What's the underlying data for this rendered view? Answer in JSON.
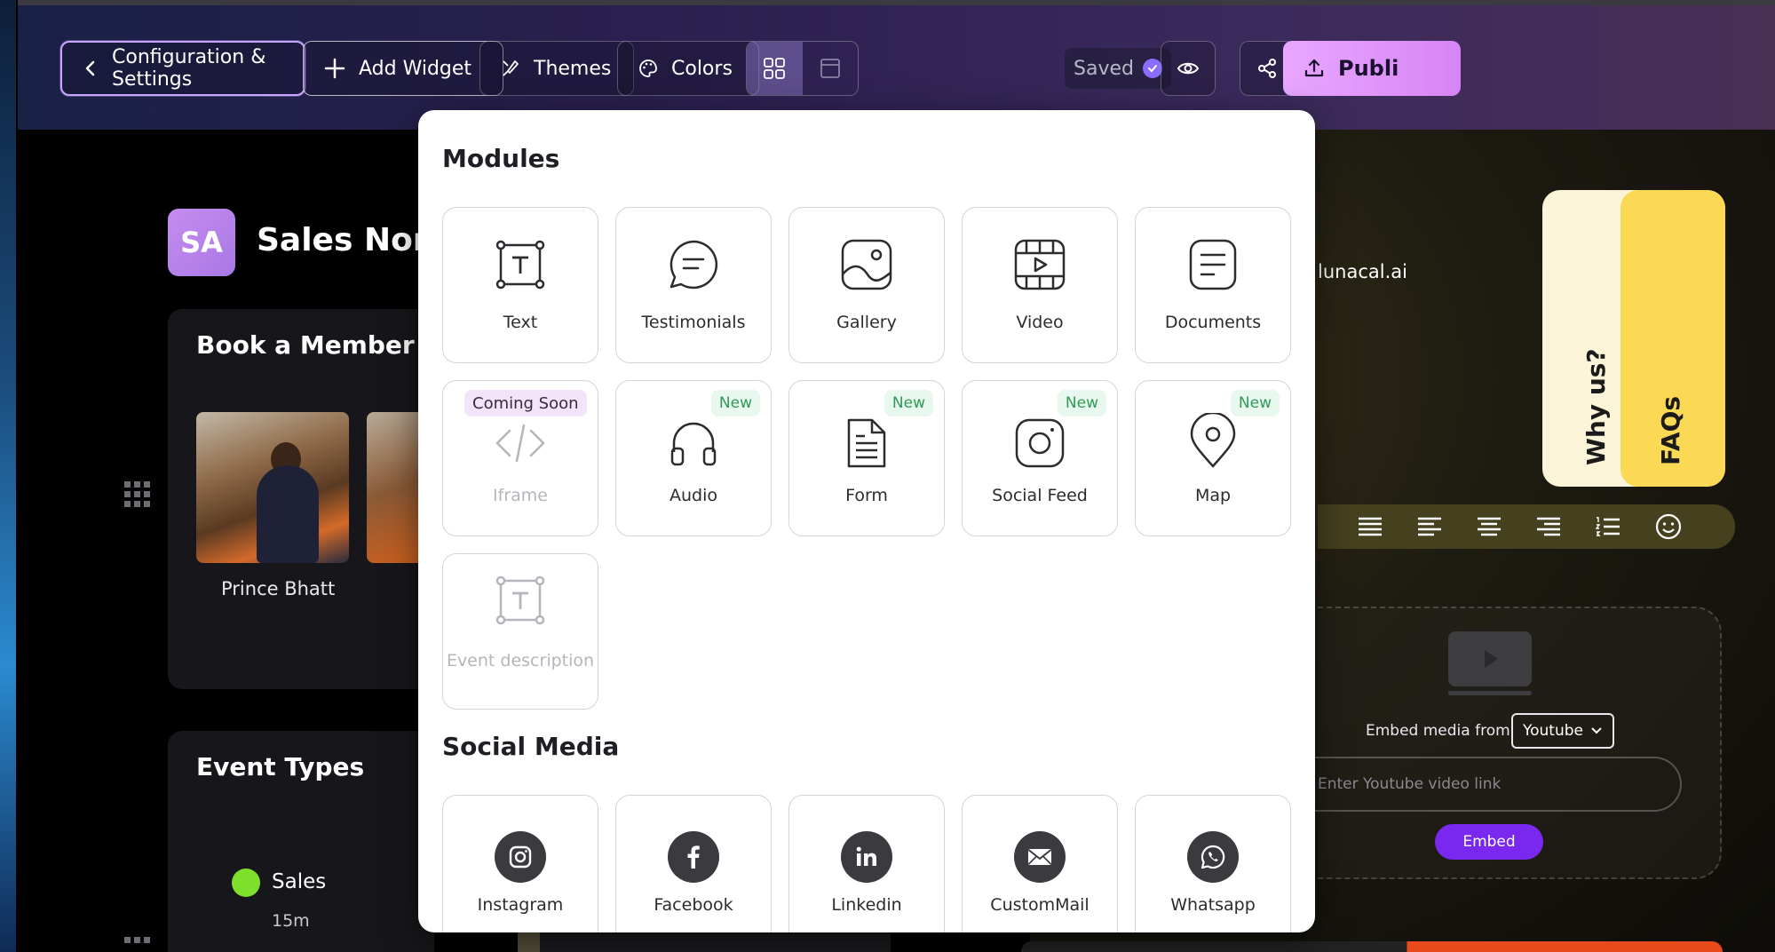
{
  "topbar": {
    "config_label": "Configuration & Settings",
    "add_widget_label": "Add Widget",
    "themes_label": "Themes",
    "colors_label": "Colors",
    "saved_label": "Saved",
    "publish_label": "Publi"
  },
  "background": {
    "org_initials": "SA",
    "org_name": "Sales Nort",
    "book_title": "Book a Member Di",
    "member_name": "Prince Bhatt",
    "events_title": "Event Types",
    "event_name": "Sales",
    "event_duration": "15m",
    "brand_url": "lunacal.ai",
    "tab_why": "Why us?",
    "tab_faq": "FAQs",
    "embed_from_label": "Embed media from",
    "embed_source": "Youtube",
    "embed_placeholder": "Enter Youtube video link",
    "embed_button": "Embed"
  },
  "modal": {
    "modules_title": "Modules",
    "modules": [
      {
        "label": "Text",
        "icon": "text-icon",
        "badge": ""
      },
      {
        "label": "Testimonials",
        "icon": "chat-bubble-icon",
        "badge": ""
      },
      {
        "label": "Gallery",
        "icon": "image-icon",
        "badge": ""
      },
      {
        "label": "Video",
        "icon": "video-icon",
        "badge": ""
      },
      {
        "label": "Documents",
        "icon": "document-icon",
        "badge": ""
      },
      {
        "label": "Iframe",
        "icon": "code-icon",
        "badge": "Coming Soon"
      },
      {
        "label": "Audio",
        "icon": "headphones-icon",
        "badge": "New"
      },
      {
        "label": "Form",
        "icon": "form-icon",
        "badge": "New"
      },
      {
        "label": "Social Feed",
        "icon": "instagram-outline-icon",
        "badge": "New"
      },
      {
        "label": "Map",
        "icon": "map-pin-icon",
        "badge": "New"
      },
      {
        "label": "Event description",
        "icon": "text-icon",
        "badge": ""
      }
    ],
    "social_title": "Social Media",
    "social": [
      {
        "label": "Instagram",
        "icon": "instagram-icon"
      },
      {
        "label": "Facebook",
        "icon": "facebook-icon"
      },
      {
        "label": "Linkedin",
        "icon": "linkedin-icon"
      },
      {
        "label": "CustomMail",
        "icon": "mail-icon"
      },
      {
        "label": "Whatsapp",
        "icon": "whatsapp-icon"
      }
    ]
  },
  "colors": {
    "accent_purple": "#7a28f0",
    "publish_pink": "#e9a7ff",
    "new_badge_green": "#2f9a57",
    "event_dot_green": "#7ee02a",
    "faq_yellow": "#fbd955"
  }
}
